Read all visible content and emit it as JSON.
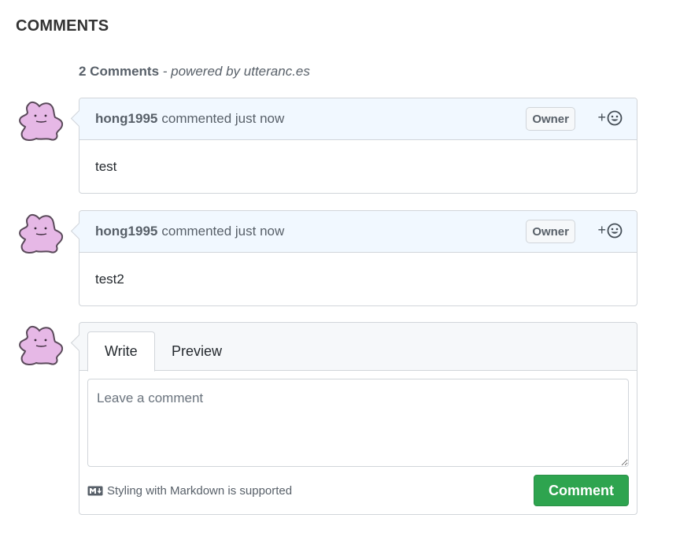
{
  "section": {
    "title": "COMMENTS"
  },
  "summary": {
    "count": "2 Comments",
    "powered_by": "- powered by utteranc.es"
  },
  "comments": [
    {
      "author": "hong1995",
      "meta": "commented just now",
      "badge": "Owner",
      "reaction": "+",
      "body": "test"
    },
    {
      "author": "hong1995",
      "meta": "commented just now",
      "badge": "Owner",
      "reaction": "+",
      "body": "test2"
    }
  ],
  "editor": {
    "tabs": [
      "Write",
      "Preview"
    ],
    "active_tab": "Write",
    "placeholder": "Leave a comment",
    "markdown_hint": "Styling with Markdown is supported",
    "submit_label": "Comment"
  },
  "icons": {
    "avatar": "ditto-avatar-icon",
    "reaction": "smiley-icon",
    "markdown": "markdown-icon"
  },
  "colors": {
    "header_bg": "#f1f8ff",
    "border": "#d1d5da",
    "button": "#2ea44f",
    "avatar": "#e6b8e6"
  }
}
